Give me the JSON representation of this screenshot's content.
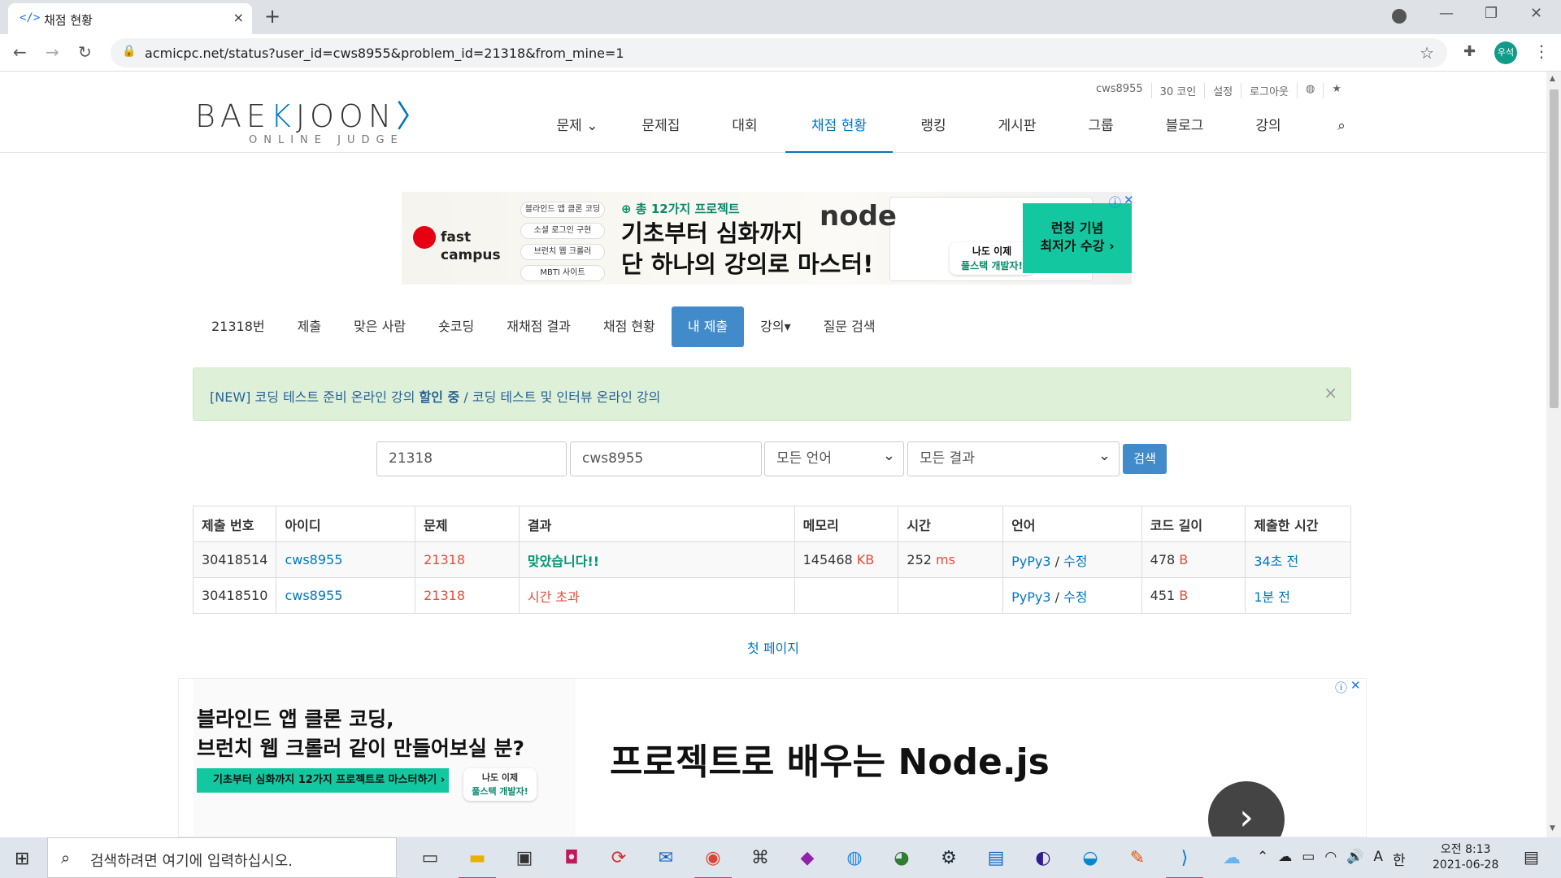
{
  "browser": {
    "tab_icon": "</>",
    "tab_title": "채점 현황",
    "tab_close": "×",
    "new_tab": "+",
    "url": "acmicpc.net/status?user_id=cws8955&problem_id=21318&from_mine=1",
    "avatar_text": "우석"
  },
  "header": {
    "logo_text_left": "BAE",
    "logo_k": "K",
    "logo_text_right": "JOON",
    "logo_sub": "ONLINE JUDGE",
    "top_links": [
      "cws8955",
      "30 코인",
      "설정",
      "로그아웃"
    ],
    "nav": [
      {
        "label": "문제 ⌄",
        "active": false
      },
      {
        "label": "문제집",
        "active": false
      },
      {
        "label": "대회",
        "active": false
      },
      {
        "label": "채점 현황",
        "active": true
      },
      {
        "label": "랭킹",
        "active": false
      },
      {
        "label": "게시판",
        "active": false
      },
      {
        "label": "그룹",
        "active": false
      },
      {
        "label": "블로그",
        "active": false
      },
      {
        "label": "강의",
        "active": false
      }
    ]
  },
  "ad_top": {
    "brand_line1": "fast",
    "brand_line2": "campus",
    "tags": [
      "블라인드 앱 클론 코딩",
      "소셜 로그인 구현",
      "브런치 웹 크롤러",
      "MBTI 사이트"
    ],
    "subtitle": "⊕ 총 12가지 프로젝트",
    "headline1": "기초부터 심화까지",
    "headline2": "단 하나의 강의로 마스터!",
    "node": "node",
    "badge1": "나도 이제",
    "badge2": "풀스택 개발자!",
    "cta1": "런칭 기념",
    "cta2": "최저가 수강 ›"
  },
  "problem_menu": [
    {
      "label": "21318번",
      "active": false
    },
    {
      "label": "제출",
      "active": false
    },
    {
      "label": "맞은 사람",
      "active": false
    },
    {
      "label": "숏코딩",
      "active": false
    },
    {
      "label": "재채점 결과",
      "active": false
    },
    {
      "label": "채점 현황",
      "active": false
    },
    {
      "label": "내 제출",
      "active": true
    },
    {
      "label": "강의▾",
      "active": false
    },
    {
      "label": "질문 검색",
      "active": false
    }
  ],
  "alert": {
    "prefix": "[NEW] 코딩 테스트 준비 온라인 강의 ",
    "bold": "할인 중",
    "suffix": " / 코딩 테스트 및 인터뷰 온라인 강의",
    "close": "×"
  },
  "search": {
    "problem_id": "21318",
    "user_id": "cws8955",
    "language": "모든 언어",
    "result": "모든 결과",
    "button": "검색"
  },
  "table": {
    "headers": [
      "제출 번호",
      "아이디",
      "문제",
      "결과",
      "메모리",
      "시간",
      "언어",
      "코드 길이",
      "제출한 시간"
    ],
    "rows": [
      {
        "id": "30418514",
        "user": "cws8955",
        "problem": "21318",
        "result": "맞았습니다!!",
        "memory": "145468",
        "memory_unit": "KB",
        "time": "252",
        "time_unit": "ms",
        "lang": "PyPy3",
        "sep": " / ",
        "edit": "수정",
        "length": "478",
        "length_unit": "B",
        "submitted": "34초 전"
      },
      {
        "id": "30418510",
        "user": "cws8955",
        "problem": "21318",
        "result": "시간 초과",
        "memory": "",
        "memory_unit": "",
        "time": "",
        "time_unit": "",
        "lang": "PyPy3",
        "sep": " / ",
        "edit": "수정",
        "length": "451",
        "length_unit": "B",
        "submitted": "1분 전"
      }
    ]
  },
  "pagination": {
    "first_page": "첫 페이지"
  },
  "ad_bottom": {
    "line1": "블라인드 앱 클론 코딩,",
    "line2": "브런치 웹 크롤러 같이 만들어보실 분?",
    "strip": "기초부터 심화까지 12가지 프로젝트로 마스터하기 ›",
    "badge1": "나도 이제",
    "badge2": "풀스택 개발자!",
    "title": "프로젝트로 배우는 Node.js",
    "arrow": "›"
  },
  "taskbar": {
    "search_placeholder": "검색하려면 여기에 입력하십시오.",
    "time": "오전 8:13",
    "date": "2021-06-28",
    "ime": "한",
    "ime2": "A"
  },
  "colors": {
    "accent": "#0076c0",
    "active_tab_bg": "#428bca",
    "accepted": "#009874",
    "error": "#e74c3c",
    "alert_bg": "#dff0d8"
  }
}
